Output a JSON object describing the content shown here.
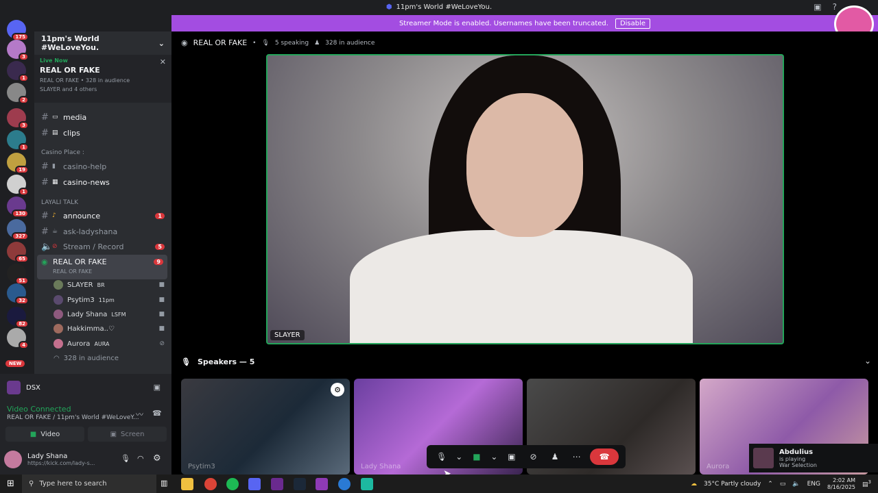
{
  "window": {
    "title": "11pm's World #WeLoveYou."
  },
  "banner": {
    "text": "Streamer Mode is enabled. Usernames have been truncated.",
    "button": "Disable"
  },
  "guilds": [
    {
      "badge": "175"
    },
    {
      "badge": "3"
    },
    {
      "badge": "1"
    },
    {
      "badge": "2"
    },
    {
      "badge": "3"
    },
    {
      "badge": "1"
    },
    {
      "badge": "19"
    },
    {
      "badge": "1"
    },
    {
      "badge": "130"
    },
    {
      "badge": "327"
    },
    {
      "badge": "65"
    },
    {
      "badge": "51"
    },
    {
      "badge": "32"
    },
    {
      "badge": "82"
    },
    {
      "badge": "4"
    }
  ],
  "guild_new": "NEW",
  "server": {
    "name": "11pm's World #WeLoveYou."
  },
  "live": {
    "label": "Live Now",
    "title": "REAL OR FAKE",
    "sub": "REAL OR FAKE • 328 in audience",
    "people": "SLAYER and 4 others"
  },
  "channels": {
    "media": "media",
    "clips": "clips",
    "cat_casino": "Casino Place :",
    "casino_help": "casino-help",
    "casino_news": "casino-news",
    "cat_layali": "LAYALI TALK",
    "announce": "announce",
    "announce_count": "1",
    "ask": "ask-ladyshana",
    "stream": "Stream / Record",
    "stream_count": "5",
    "vc_name": "REAL OR FAKE",
    "vc_sub": "REAL OR FAKE",
    "vc_count": "9"
  },
  "speakers": [
    {
      "name": "SLAYER",
      "tag": "BR"
    },
    {
      "name": "Psytim3",
      "tag": "11pm"
    },
    {
      "name": "Lady Shana",
      "tag": "LSFM"
    },
    {
      "name": "Hakkimma..♡",
      "tag": ""
    },
    {
      "name": "Aurora",
      "tag": "AURA"
    }
  ],
  "audience": "328 in audience",
  "panel": {
    "activity": "DSX",
    "voice_status": "Video Connected",
    "voice_channel": "REAL OR FAKE / 11pm's World #WeLoveY...",
    "video_btn": "Video",
    "screen_btn": "Screen",
    "user": "Lady Shana",
    "user_status": "https://kick.com/lady-s..."
  },
  "main": {
    "stage_title": "REAL OR FAKE",
    "speaking": "5 speaking",
    "audience": "328 in audience",
    "focused": "SLAYER",
    "speakers_header": "Speakers — 5",
    "tiles": [
      "Psytim3",
      "Lady Shana",
      "",
      "Aurora"
    ]
  },
  "toast": {
    "name": "Abdulius",
    "status": "is playing",
    "game": "War Selection"
  },
  "notif_count": "9",
  "taskbar": {
    "search_placeholder": "Type here to search",
    "weather": "35°C  Partly cloudy",
    "lang": "ENG",
    "time": "2:02 AM",
    "date": "8/16/2025",
    "notif": "3"
  },
  "colors": {
    "accent": "#a34de1",
    "green": "#23a55a",
    "red": "#da373c"
  }
}
